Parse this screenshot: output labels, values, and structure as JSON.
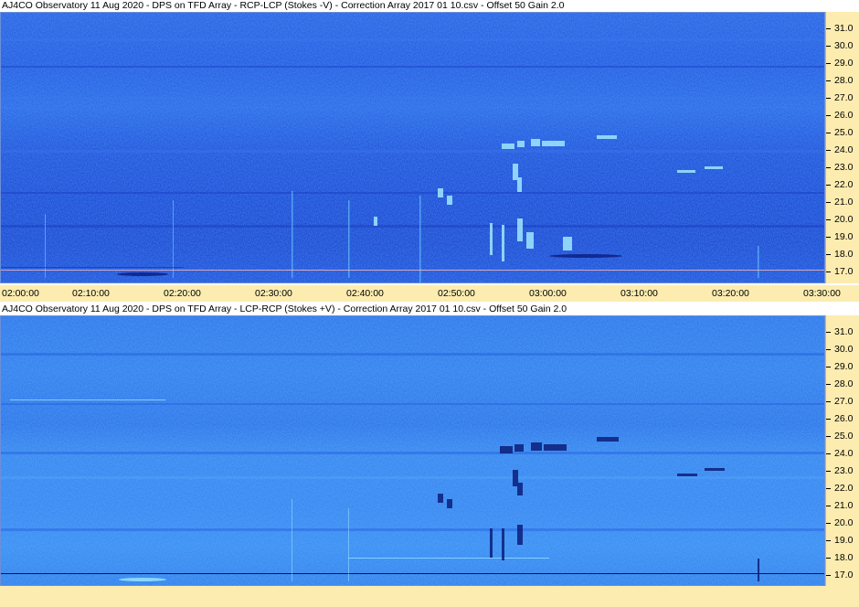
{
  "panels": [
    {
      "title": "AJ4CO Observatory 11 Aug 2020  -  DPS on TFD Array  -  RCP-LCP (Stokes -V)  -  Correction Array 2017 01 10.csv  -  Offset 50  Gain 2.0",
      "freq_labels": [
        "31.0",
        "30.0",
        "29.0",
        "28.0",
        "27.0",
        "26.0",
        "25.0",
        "24.0",
        "23.0",
        "22.0",
        "21.0",
        "20.0",
        "19.0",
        "18.0",
        "17.0"
      ]
    },
    {
      "title": "AJ4CO Observatory 11 Aug 2020  -  DPS on TFD Array  -  LCP-RCP (Stokes +V)  -  Correction Array 2017 01 10.csv  -  Offset 50  Gain 2.0",
      "freq_labels": [
        "31.0",
        "30.0",
        "29.0",
        "28.0",
        "27.0",
        "26.0",
        "25.0",
        "24.0",
        "23.0",
        "22.0",
        "21.0",
        "20.0",
        "19.0",
        "18.0",
        "17.0"
      ]
    }
  ],
  "time_labels": [
    "02:00:00",
    "02:10:00",
    "02:20:00",
    "02:30:00",
    "02:40:00",
    "02:50:00",
    "03:00:00",
    "03:10:00",
    "03:20:00",
    "03:30:00"
  ],
  "colors": {
    "panel_bg": "#fcecb0",
    "spectro_dark": "#1c3fd6",
    "spectro_light": "#2c7af0"
  }
}
